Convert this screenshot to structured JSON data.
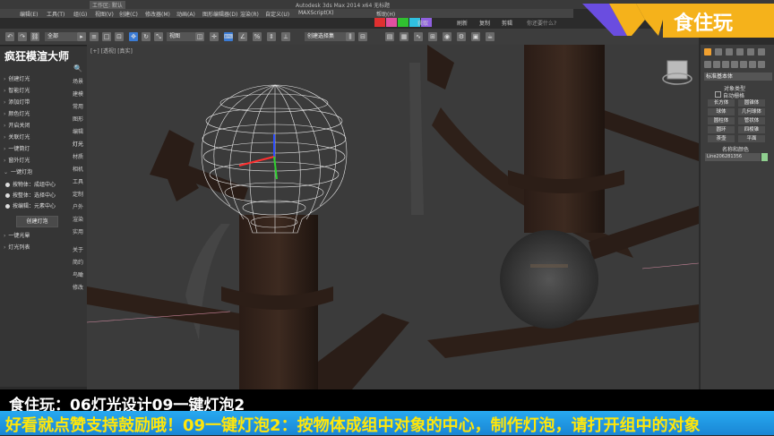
{
  "app": {
    "workspace": "工作区: 默认",
    "title": "Autodesk 3ds Max 2014 x64     无标题"
  },
  "menu": [
    "编辑(E)",
    "工具(T)",
    "组(G)",
    "视图(V)",
    "创建(C)",
    "修改器(M)",
    "动画(A)",
    "图形编辑器(D)",
    "渲染(R)",
    "自定义(U)",
    "MAXScript(X)",
    "帮助(H)"
  ],
  "menu_right": [
    "获取",
    "刷新",
    "复制",
    "剪辑",
    "你还要什么?"
  ],
  "swatch_colors": [
    "#e03030",
    "#e050a0",
    "#30c030",
    "#30c0e0",
    "#9060e0",
    "#f0f0f0",
    "#dddddd",
    "#cccccc"
  ],
  "toolbar": {
    "selection_filter": "全部",
    "view_dropdown": "视图",
    "named_set": "创建选择集"
  },
  "left_panel": {
    "title": "疯狂模渲大师",
    "items": [
      "创建灯光",
      "智能灯光",
      "添加灯带",
      "颜色灯光",
      "开启关闭",
      "关联灯光",
      "一键筒灯",
      "窗外灯光",
      "一键灯泡"
    ],
    "radio_options": [
      "按物体：成组中心",
      "按整体：选择中心",
      "按编辑：元素中心"
    ],
    "create_button": "创建灯泡",
    "bottom_items": [
      "一键光晕",
      "灯光列表"
    ],
    "tabs": [
      "场景",
      "建模",
      "常用",
      "图形",
      "编辑",
      "灯光",
      "材质",
      "相机",
      "工具",
      "定制",
      "户外",
      "渲染",
      "实用",
      "关于",
      "简约",
      "鸟瞰",
      "修改"
    ]
  },
  "viewport": {
    "label": "[+] [透视] [真实]"
  },
  "command_panel": {
    "category": "标准基本体",
    "rollout_title": "对象类型",
    "autogrid": "自动栅格",
    "buttons": [
      "长方体",
      "圆锥体",
      "球体",
      "几何球体",
      "圆柱体",
      "管状体",
      "圆环",
      "四棱锥",
      "茶壶",
      "平面"
    ],
    "name_color_title": "名称和颜色",
    "name_value": "Line206281356"
  },
  "overlay": {
    "logo": "食住玩",
    "caption": "食住玩：06灯光设计09一键灯泡2",
    "subtitle": "好看就点赞支持鼓励哦！09一键灯泡2：按物体成组中对象的中心，制作灯泡，请打开组中的对象"
  }
}
